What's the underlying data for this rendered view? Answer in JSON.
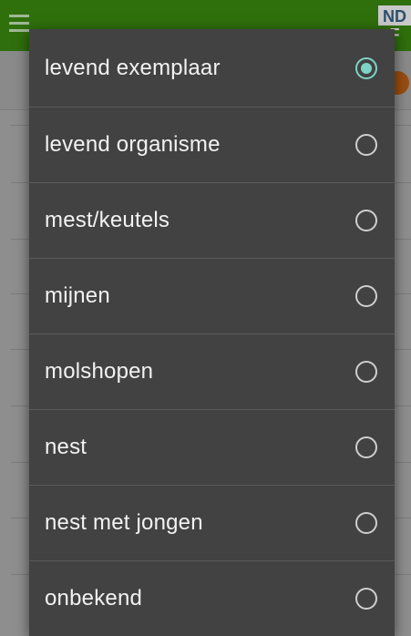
{
  "background": {
    "menu_icon": "hamburger-icon",
    "logo_top": "ND",
    "logo_bottom": "F"
  },
  "dialog": {
    "accent_color": "#7ed3c6",
    "options": [
      {
        "label": "levend exemplaar",
        "selected": true
      },
      {
        "label": "levend organisme",
        "selected": false
      },
      {
        "label": "mest/keutels",
        "selected": false
      },
      {
        "label": "mijnen",
        "selected": false
      },
      {
        "label": "molshopen",
        "selected": false
      },
      {
        "label": "nest",
        "selected": false
      },
      {
        "label": "nest met jongen",
        "selected": false
      },
      {
        "label": "onbekend",
        "selected": false
      }
    ]
  }
}
